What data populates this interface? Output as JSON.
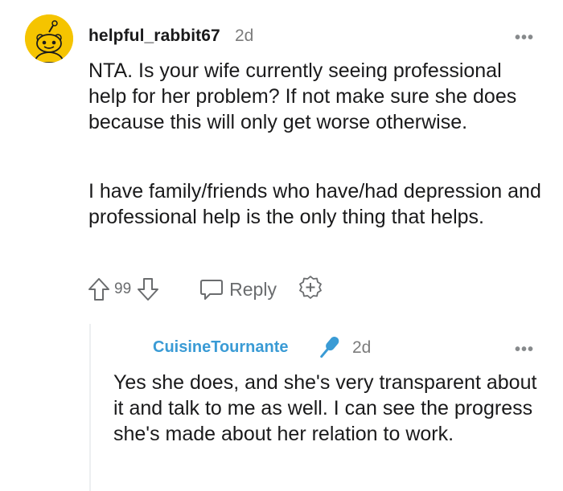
{
  "comment": {
    "author": "helpful_rabbit67",
    "age": "2d",
    "more_label": "•••",
    "paragraphs": [
      "NTA. Is your wife currently seeing professional help for her problem? If not make sure she does because this will only get worse otherwise.",
      "I have family/friends who have/had depression and professional help is the only thing that helps."
    ],
    "votes": "99",
    "reply_label": "Reply",
    "icons": [
      "avatar",
      "upvote-icon",
      "downvote-icon",
      "reply-icon",
      "award-icon",
      "more-icon"
    ]
  },
  "reply": {
    "author": "CuisineTournante",
    "age": "2d",
    "more_label": "•••",
    "flair_icon": "microphone-icon",
    "paragraphs": [
      "Yes she does, and she's very transparent about it and talk to me as well. I can see the progress she's made about her relation to work."
    ]
  },
  "colors": {
    "avatar_bg": "#f5c400",
    "reply_author": "#3a9bd5",
    "mic": "#3a9bd5",
    "meta_text": "#7c7c7c",
    "icon_gray": "#878a8c"
  }
}
